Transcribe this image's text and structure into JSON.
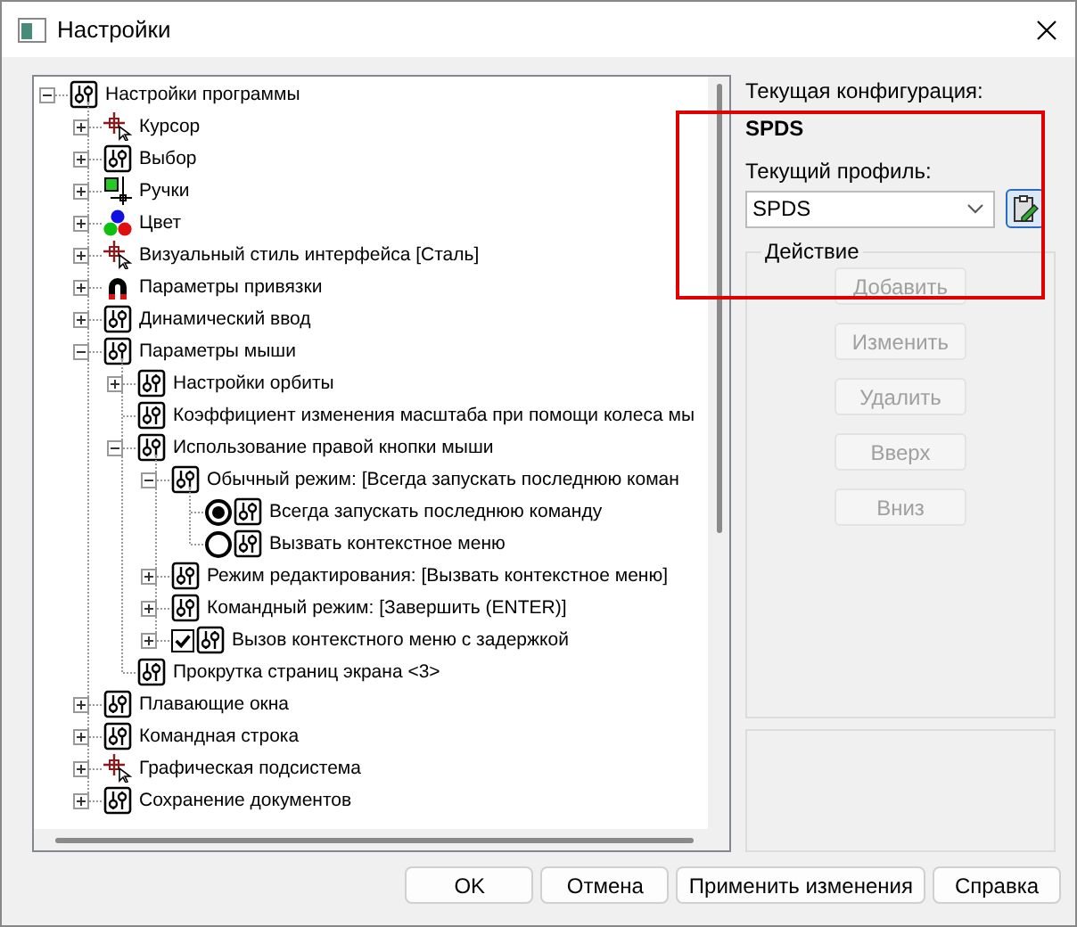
{
  "window": {
    "title": "Настройки"
  },
  "tree": [
    {
      "label": "Настройки программы",
      "kind": "settings",
      "expanded": true,
      "children": [
        {
          "label": "Курсор",
          "kind": "cursor",
          "expanded": false
        },
        {
          "label": "Выбор",
          "kind": "settings",
          "expanded": false
        },
        {
          "label": "Ручки",
          "kind": "grips",
          "expanded": false
        },
        {
          "label": "Цвет",
          "kind": "color",
          "expanded": false
        },
        {
          "label": "Визуальный стиль интерфейса [Сталь]",
          "kind": "cursor",
          "expanded": false
        },
        {
          "label": "Параметры привязки",
          "kind": "magnet",
          "expanded": false
        },
        {
          "label": "Динамический ввод",
          "kind": "settings",
          "expanded": false
        },
        {
          "label": "Параметры мыши",
          "kind": "settings",
          "expanded": true,
          "children": [
            {
              "label": "Настройки орбиты",
              "kind": "settings",
              "expanded": false
            },
            {
              "label": "Коэффициент изменения масштаба при помощи колеса мы",
              "kind": "settings"
            },
            {
              "label": "Использование правой кнопки мыши",
              "kind": "settings",
              "expanded": true,
              "children": [
                {
                  "label": "Обычный режим: [Всегда запускать последнюю коман",
                  "kind": "settings",
                  "expanded": true,
                  "children": [
                    {
                      "label": "Всегда запускать последнюю команду",
                      "kind": "radio",
                      "checked": true
                    },
                    {
                      "label": "Вызвать контекстное меню",
                      "kind": "radio",
                      "checked": false
                    }
                  ]
                },
                {
                  "label": "Режим редактирования: [Вызвать контекстное меню]",
                  "kind": "settings",
                  "expanded": false
                },
                {
                  "label": "Командный режим: [Завершить (ENTER)]",
                  "kind": "settings",
                  "expanded": false
                },
                {
                  "label": "Вызов контекстного меню с задержкой",
                  "kind": "checkbox",
                  "checked": true,
                  "expanded": false
                }
              ]
            },
            {
              "label": "Прокрутка страниц экрана <3>",
              "kind": "settings"
            }
          ]
        },
        {
          "label": "Плавающие окна",
          "kind": "settings",
          "expanded": false
        },
        {
          "label": "Командная строка",
          "kind": "settings",
          "expanded": false
        },
        {
          "label": "Графическая подсистема",
          "kind": "cursor",
          "expanded": false
        },
        {
          "label": "Сохранение документов",
          "kind": "settings",
          "expanded": false
        }
      ]
    }
  ],
  "config": {
    "label": "Текущая конфигурация:",
    "value": "SPDS"
  },
  "profile": {
    "label": "Текущий профиль:",
    "value": "SPDS"
  },
  "action_group": {
    "title": "Действие",
    "buttons": [
      {
        "label": "Добавить",
        "disabled": true
      },
      {
        "label": "Изменить",
        "disabled": true
      },
      {
        "label": "Удалить",
        "disabled": true
      },
      {
        "label": "Вверх",
        "disabled": true
      },
      {
        "label": "Вниз",
        "disabled": true
      }
    ]
  },
  "footer_buttons": [
    "OK",
    "Отмена",
    "Применить изменения",
    "Справка"
  ]
}
